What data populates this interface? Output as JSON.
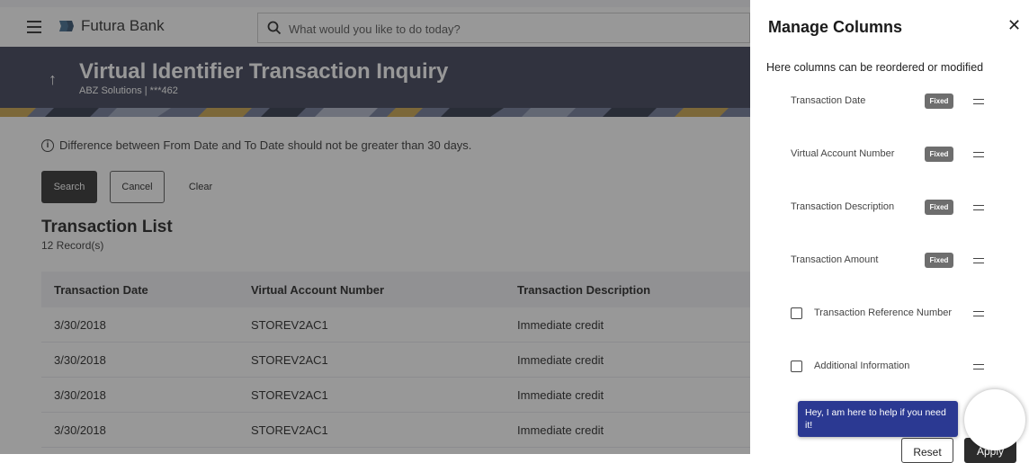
{
  "header": {
    "brand": "Futura Bank",
    "search_placeholder": "What would you like to do today?"
  },
  "page": {
    "title": "Virtual Identifier Transaction Inquiry",
    "subtitle": "ABZ Solutions | ***462"
  },
  "info_message": "Difference between From Date and To Date should not be greater than 30 days.",
  "buttons": {
    "search": "Search",
    "cancel": "Cancel",
    "clear": "Clear"
  },
  "transaction_list": {
    "title": "Transaction List",
    "count": "12 Record(s)",
    "columns": [
      "Transaction Date",
      "Virtual Account Number",
      "Transaction Description"
    ],
    "rows": [
      [
        "3/30/2018",
        "STOREV2AC1",
        "Immediate credit"
      ],
      [
        "3/30/2018",
        "STOREV2AC1",
        "Immediate credit"
      ],
      [
        "3/30/2018",
        "STOREV2AC1",
        "Immediate credit"
      ],
      [
        "3/30/2018",
        "STOREV2AC1",
        "Immediate credit"
      ]
    ]
  },
  "manage_columns": {
    "title": "Manage Columns",
    "description": "Here columns can be reordered or modified",
    "fixed_label": "Fixed",
    "items": [
      {
        "label": "Transaction Date",
        "fixed": true
      },
      {
        "label": "Virtual Account Number",
        "fixed": true
      },
      {
        "label": "Transaction Description",
        "fixed": true
      },
      {
        "label": "Transaction Amount",
        "fixed": true
      },
      {
        "label": "Transaction Reference Number",
        "fixed": false,
        "checked": false
      },
      {
        "label": "Additional Information",
        "fixed": false,
        "checked": false
      }
    ],
    "reset": "Reset",
    "apply": "Apply"
  },
  "chat": {
    "message": "Hey, I am here to help if you need it!"
  },
  "colors": {
    "banner": "#3a3f55",
    "primary_button": "#2c2c2c",
    "chat_bubble": "#2b3992",
    "fixed_badge": "#6e6e6e"
  }
}
